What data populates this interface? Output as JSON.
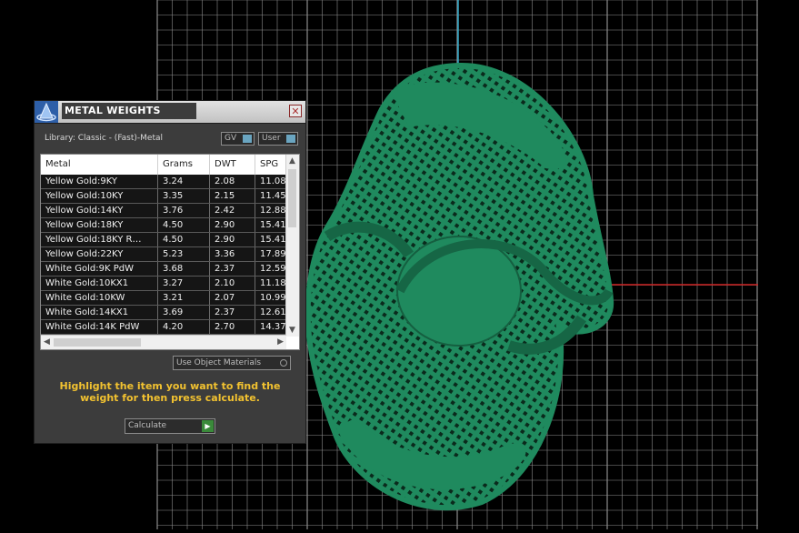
{
  "viewport": {
    "background": "#000000",
    "grid_color": "#8c8c8c",
    "axis_red": "#cc2222",
    "axis_cyan": "#2fa8c8",
    "model_color": "#1f8a5e"
  },
  "panel": {
    "title": "METAL WEIGHTS",
    "close_icon": "close-icon",
    "library_label": "Library: Classic - (Fast)-Metal",
    "gv_label": "GV",
    "user_label": "User",
    "table": {
      "headers": [
        "Metal",
        "Grams",
        "DWT",
        "SPG"
      ],
      "rows": [
        [
          "Yellow Gold:9KY",
          "3.24",
          "2.08",
          "11.08"
        ],
        [
          "Yellow Gold:10KY",
          "3.35",
          "2.15",
          "11.45"
        ],
        [
          "Yellow Gold:14KY",
          "3.76",
          "2.42",
          "12.88"
        ],
        [
          "Yellow Gold:18KY",
          "4.50",
          "2.90",
          "15.41"
        ],
        [
          "Yellow Gold:18KY R…",
          "4.50",
          "2.90",
          "15.41"
        ],
        [
          "Yellow Gold:22KY",
          "5.23",
          "3.36",
          "17.89"
        ],
        [
          "White Gold:9K PdW",
          "3.68",
          "2.37",
          "12.59"
        ],
        [
          "White Gold:10KX1",
          "3.27",
          "2.10",
          "11.18"
        ],
        [
          "White Gold:10KW",
          "3.21",
          "2.07",
          "10.99"
        ],
        [
          "White Gold:14KX1",
          "3.69",
          "2.37",
          "12.61"
        ],
        [
          "White Gold:14K PdW",
          "4.20",
          "2.70",
          "14.37"
        ]
      ]
    },
    "use_object_materials": "Use Object Materials",
    "instruction": "Highlight the item you want to find the weight for then press calculate.",
    "calculate_label": "Calculate"
  }
}
